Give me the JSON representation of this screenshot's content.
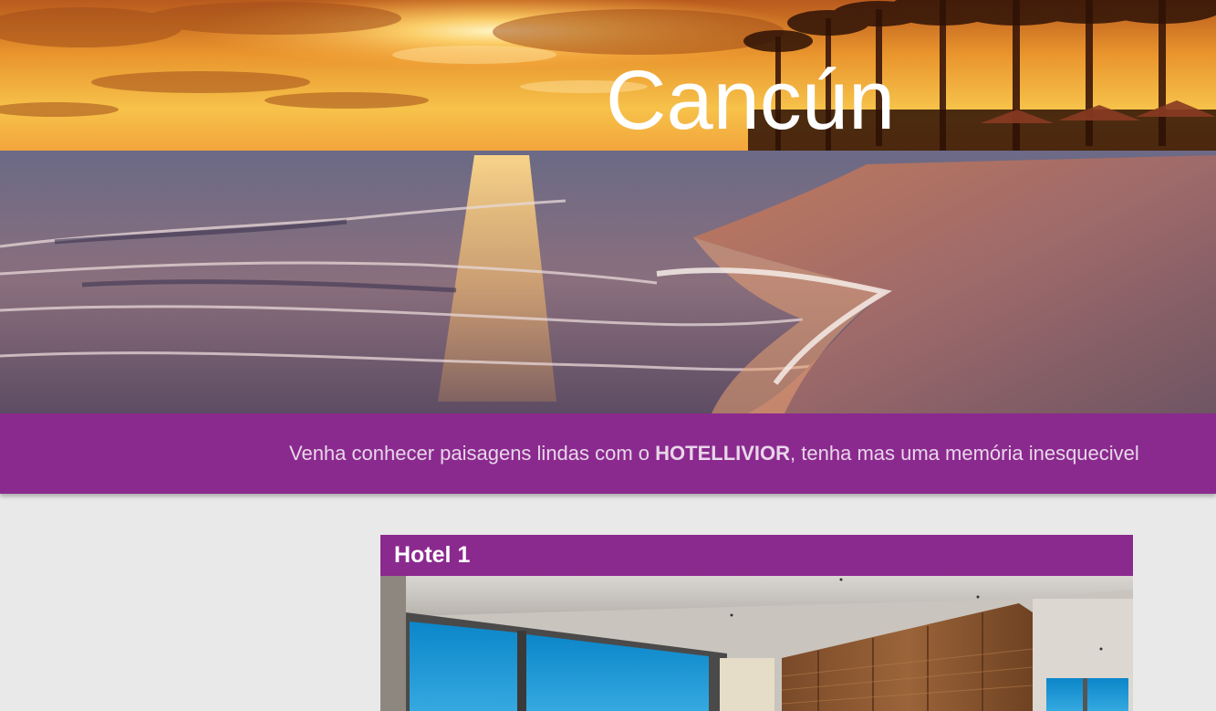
{
  "hero": {
    "title": "Cancún",
    "image": "beach-sunset-image"
  },
  "banner": {
    "text_before": "Venha conhecer paisagens lindas com o ",
    "brand": "HOTELLIVIOR",
    "text_after": ", tenha mas uma memória inesquecivel"
  },
  "hotel_card": {
    "title": "Hotel 1",
    "image": "hotel-room-image"
  },
  "colors": {
    "accent": "#8b2a8e",
    "page_background": "#e9e9e9"
  }
}
